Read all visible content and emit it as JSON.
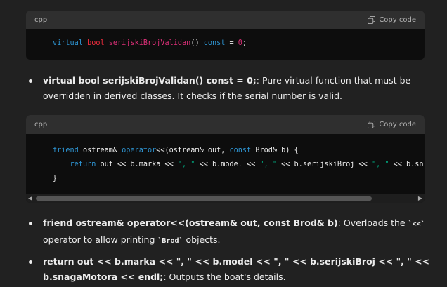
{
  "block1": {
    "language": "cpp",
    "copy_label": "Copy code",
    "line": {
      "kw": "virtual",
      "type": "bool",
      "fn": "serijskiBrojValidan",
      "mid": "() ",
      "const_kw": "const",
      "eq": " = ",
      "num": "0",
      "end": ";"
    }
  },
  "bullet1": {
    "bold": "virtual bool serijskiBrojValidan() const = 0;",
    "text": ": Pure virtual function that must be overridden in derived classes. It checks if the serial number is valid."
  },
  "block2": {
    "language": "cpp",
    "copy_label": "Copy code",
    "l1": {
      "kw": "friend",
      "a": " ostream& ",
      "op": "operator",
      "b": "<<(ostream& out, ",
      "const_kw": "const",
      "c": " Brod& b) {"
    },
    "l2": {
      "kw": "return",
      "a": " out << b.marka << ",
      "s1": "\", \"",
      "b": " << b.model << ",
      "s2": "\", \"",
      "c": " << b.serijskiBroj << ",
      "s3": "\", \"",
      "d": " << b.sn"
    },
    "l3": "}"
  },
  "bullet2": {
    "bold": "friend ostream& operator<<(ostream& out, const Brod& b)",
    "text1": ": Overloads the ",
    "code1": "`<<`",
    "text2": " operator to allow printing ",
    "code2": "`Brod`",
    "text3": " objects."
  },
  "bullet3": {
    "bold": "return out << b.marka << \", \" << b.model << \", \" << b.serijskiBroj << \", \" << b.snagaMotora << endl;",
    "text": ": Outputs the boat's details."
  }
}
